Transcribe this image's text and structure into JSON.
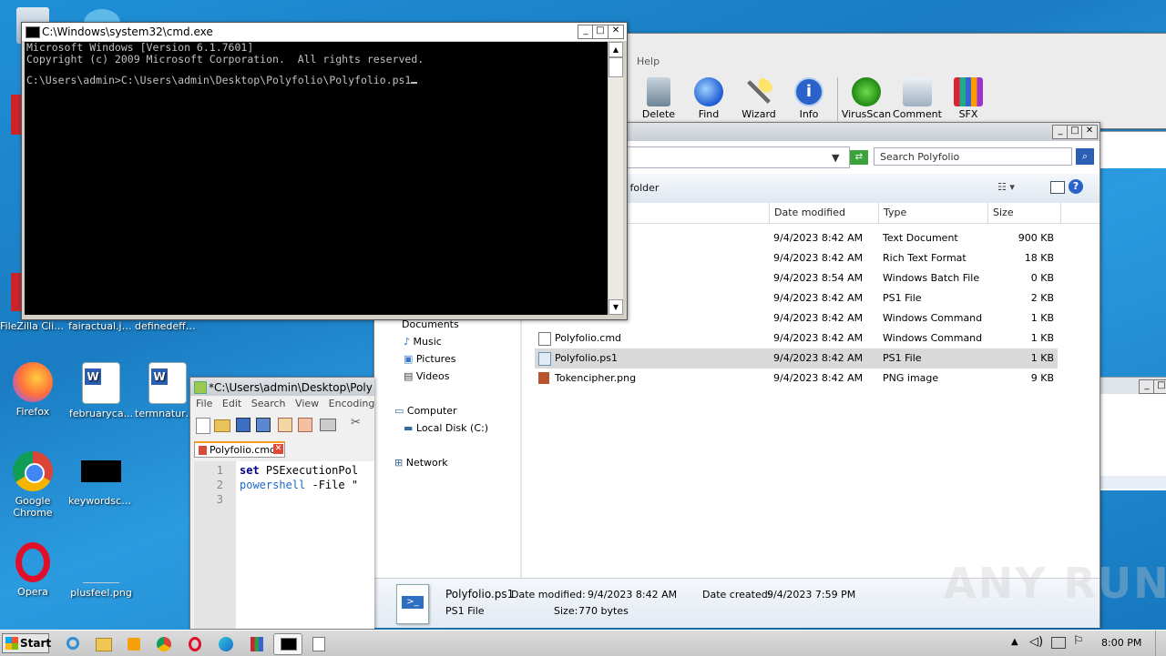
{
  "desktop": {
    "icons": [
      {
        "label": "FileZilla Client"
      },
      {
        "label": "fairactual.jpg"
      },
      {
        "label": "definedeffe..."
      },
      {
        "label": "Firefox"
      },
      {
        "label": "februaryca..."
      },
      {
        "label": "termnatura..."
      },
      {
        "label": "Google Chrome"
      },
      {
        "label": "keywordsca..."
      },
      {
        "label": "Opera"
      },
      {
        "label": "plusfeel.png"
      }
    ]
  },
  "cmd": {
    "title": "C:\\Windows\\system32\\cmd.exe",
    "line1": "Microsoft Windows [Version 6.1.7601]",
    "line2": "Copyright (c) 2009 Microsoft Corporation.  All rights reserved.",
    "line3": "C:\\Users\\admin>C:\\Users\\admin\\Desktop\\Polyfolio\\Polyfolio.ps1"
  },
  "winrar": {
    "menu_help": "Help",
    "toolbar": [
      {
        "label": "Delete",
        "icon": "trash-icon"
      },
      {
        "label": "Find",
        "icon": "magnifier-icon"
      },
      {
        "label": "Wizard",
        "icon": "wand-icon"
      },
      {
        "label": "Info",
        "icon": "info-icon"
      },
      {
        "label": "VirusScan",
        "icon": "bug-icon"
      },
      {
        "label": "Comment",
        "icon": "comment-icon"
      },
      {
        "label": "SFX",
        "icon": "archive-icon"
      }
    ]
  },
  "explorer": {
    "search_placeholder": "Search Polyfolio",
    "new_folder": "w folder",
    "columns": {
      "date": "Date modified",
      "type": "Type",
      "size": "Size"
    },
    "nav": {
      "documents": "Documents",
      "music": "Music",
      "pictures": "Pictures",
      "videos": "Videos",
      "computer": "Computer",
      "local_disk": "Local Disk (C:)",
      "network": "Network"
    },
    "files": [
      {
        "name": "",
        "date": "9/4/2023 8:42 AM",
        "type": "Text Document",
        "size": "900 KB"
      },
      {
        "name": "",
        "date": "9/4/2023 8:42 AM",
        "type": "Rich Text Format",
        "size": "18 KB"
      },
      {
        "name": "",
        "date": "9/4/2023 8:54 AM",
        "type": "Windows Batch File",
        "size": "0 KB"
      },
      {
        "name": "",
        "date": "9/4/2023 8:42 AM",
        "type": "PS1 File",
        "size": "2 KB"
      },
      {
        "name": "",
        "date": "9/4/2023 8:42 AM",
        "type": "Windows Command ...",
        "size": "1 KB"
      },
      {
        "name": "Polyfolio.cmd",
        "date": "9/4/2023 8:42 AM",
        "type": "Windows Command ...",
        "size": "1 KB"
      },
      {
        "name": "Polyfolio.ps1",
        "date": "9/4/2023 8:42 AM",
        "type": "PS1 File",
        "size": "1 KB"
      },
      {
        "name": "Tokencipher.png",
        "date": "9/4/2023 8:42 AM",
        "type": "PNG image",
        "size": "9 KB"
      }
    ],
    "details": {
      "name": "Polyfolio.ps1",
      "modified_label": "Date modified:",
      "modified": "9/4/2023 8:42 AM",
      "created_label": "Date created:",
      "created": "9/4/2023 7:59 PM",
      "kind": "PS1 File",
      "size_label": "Size:",
      "size": "770 bytes"
    }
  },
  "notepad": {
    "title": "*C:\\Users\\admin\\Desktop\\Polyf",
    "menu": [
      "File",
      "Edit",
      "Search",
      "View",
      "Encoding"
    ],
    "tab": "Polyfolio.cmd",
    "lines": [
      {
        "num": "1",
        "kw": "set",
        "rest": " PSExecutionPol"
      },
      {
        "num": "2",
        "kw": "powershell",
        "rest": " -File \""
      },
      {
        "num": "3",
        "kw": "",
        "rest": ""
      }
    ]
  },
  "taskbar": {
    "start": "Start",
    "clock": "8:00 PM"
  },
  "watermark": "ANY RUN"
}
